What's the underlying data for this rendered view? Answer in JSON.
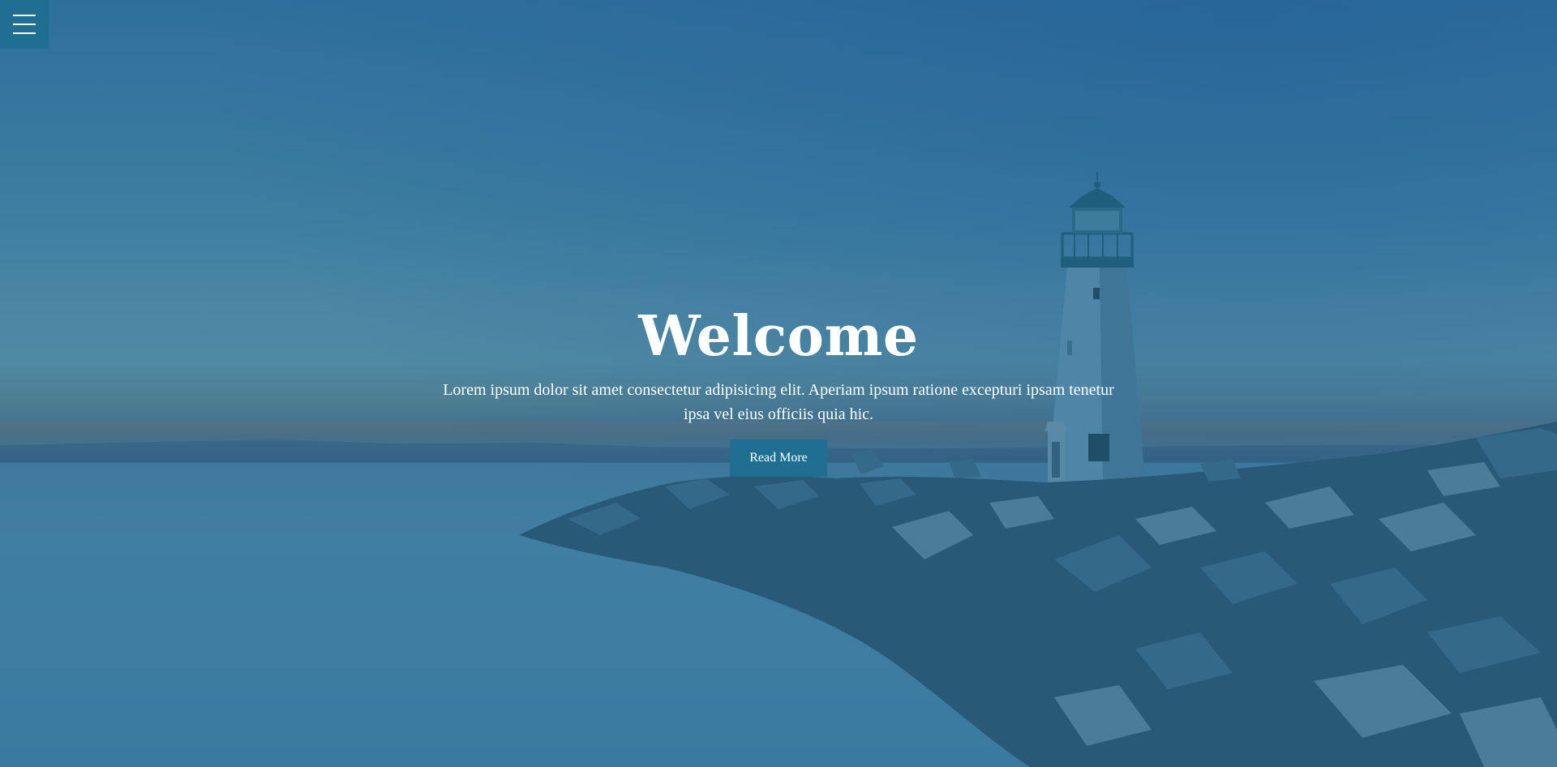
{
  "menu": {
    "icon": "hamburger-menu-icon"
  },
  "hero": {
    "title": "Welcome",
    "subtitle": "Lorem ipsum dolor sit amet consectetur adipisicing elit. Aperiam ipsum ratione excepturi ipsam tenetur ipsa vel eius officiis quia hic.",
    "button_label": "Read More"
  },
  "colors": {
    "accent": "#1e6f92",
    "overlay": "#2f6f9c",
    "text": "#ffffff"
  }
}
